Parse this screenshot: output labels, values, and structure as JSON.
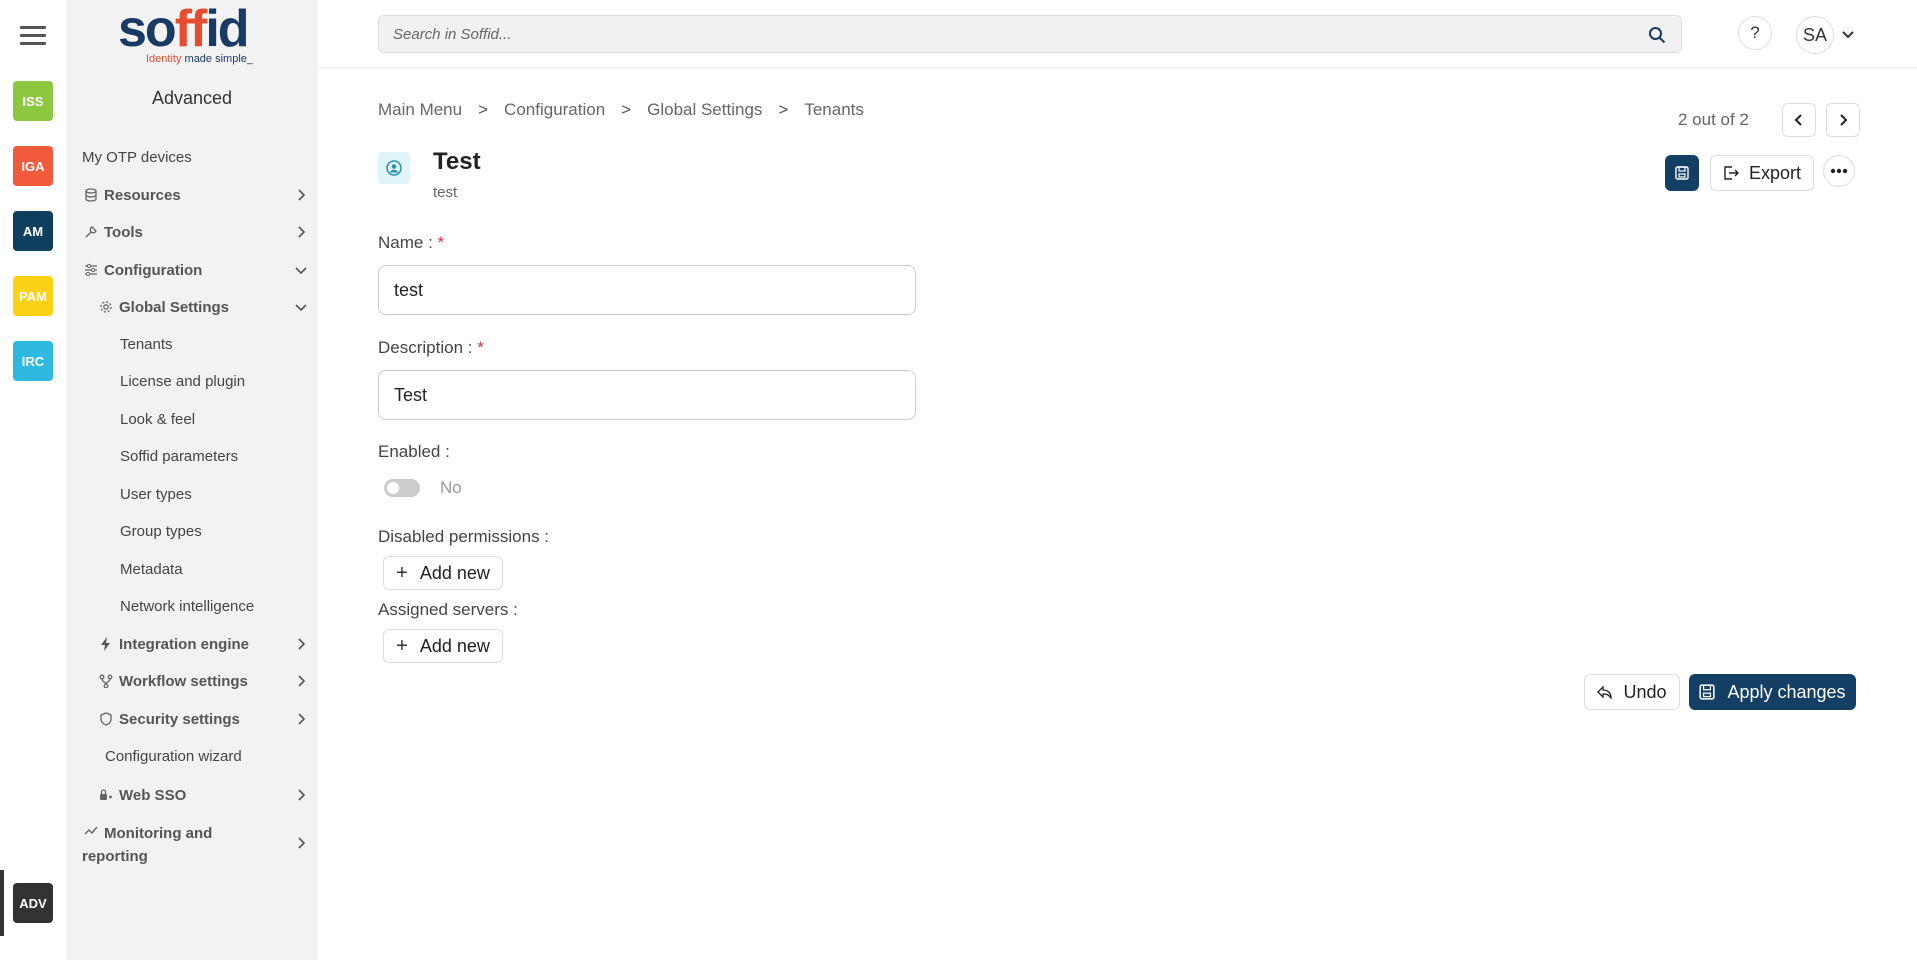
{
  "apps": [
    {
      "label": "ISS",
      "color": "#8dc63f"
    },
    {
      "label": "IGA",
      "color": "#f15a3a"
    },
    {
      "label": "AM",
      "color": "#0f3f5f"
    },
    {
      "label": "PAM",
      "color": "#fcd116"
    },
    {
      "label": "IRC",
      "color": "#2fb8e0"
    },
    {
      "label": "ADV",
      "color": "#333333"
    }
  ],
  "logo": {
    "word_a": "so",
    "word_b": "ff",
    "word_c": "i",
    "word_d": "d",
    "tag_a": "Identity ",
    "tag_b": "made simple_"
  },
  "sidebar": {
    "title": "Advanced",
    "items": [
      {
        "label": "My OTP devices"
      },
      {
        "label": "Resources"
      },
      {
        "label": "Tools"
      },
      {
        "label": "Configuration"
      },
      {
        "label": "Global Settings"
      },
      {
        "label": "Tenants"
      },
      {
        "label": "License and plugin"
      },
      {
        "label": "Look & feel"
      },
      {
        "label": "Soffid parameters"
      },
      {
        "label": "User types"
      },
      {
        "label": "Group types"
      },
      {
        "label": "Metadata"
      },
      {
        "label": "Network intelligence"
      },
      {
        "label": "Integration engine"
      },
      {
        "label": "Workflow settings"
      },
      {
        "label": "Security settings"
      },
      {
        "label": "Configuration wizard"
      },
      {
        "label": "Web SSO"
      },
      {
        "label": "Monitoring and"
      },
      {
        "label": "reporting"
      }
    ]
  },
  "topbar": {
    "search_placeholder": "Search in Soffid...",
    "help": "?",
    "avatar": "SA"
  },
  "breadcrumb": {
    "items": [
      "Main Menu",
      "Configuration",
      "Global Settings",
      "Tenants"
    ],
    "sep": ">"
  },
  "pager": {
    "text": "2 out of 2"
  },
  "entity": {
    "title": "Test",
    "subtitle": "test"
  },
  "actions": {
    "export": "Export",
    "undo": "Undo",
    "apply": "Apply changes"
  },
  "form": {
    "name_label": "Name :",
    "name_value": "test",
    "description_label": "Description :",
    "description_value": "Test",
    "required_mark": "*",
    "enabled_label": "Enabled :",
    "enabled_value": "No",
    "disabled_permissions_label": "Disabled permissions :",
    "assigned_servers_label": "Assigned servers :",
    "add_new": "Add new"
  }
}
